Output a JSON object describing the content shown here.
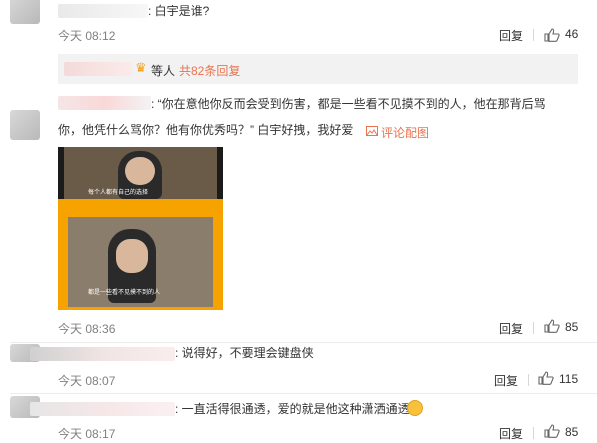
{
  "comments": [
    {
      "text": ": 白宇是谁?",
      "time": "今天 08:12",
      "reply": "回复",
      "likes": "46"
    },
    {
      "text_line1": ": “你在意他你反而会受到伤害，都是一些看不见摸不到的人，他在那背后骂",
      "text_line2": "你，他凭什么骂你？他有你优秀吗？” 白宇好拽，我好爱",
      "pic_link": "评论配图",
      "time": "今天 08:36",
      "reply": "回复",
      "likes": "85",
      "pic_captions": [
        "每个人都有自己的选择",
        "都是一些看不见摸不到的人"
      ]
    },
    {
      "text": ": 说得好，不要理会键盘侠",
      "time": "今天 08:07",
      "reply": "回复",
      "likes": "115"
    },
    {
      "text": ": 一直活得很通透，爱的就是他这种潇洒通透",
      "time": "今天 08:17",
      "reply": "回复",
      "likes": "85"
    }
  ],
  "subreply": {
    "label": "等人",
    "link": "共82条回复"
  },
  "colors": {
    "accent": "#eb7350",
    "muted": "#808080"
  },
  "icons": [
    "thumb-up-icon",
    "picture-icon",
    "heart-crown-icon",
    "smile-emoji-icon"
  ]
}
